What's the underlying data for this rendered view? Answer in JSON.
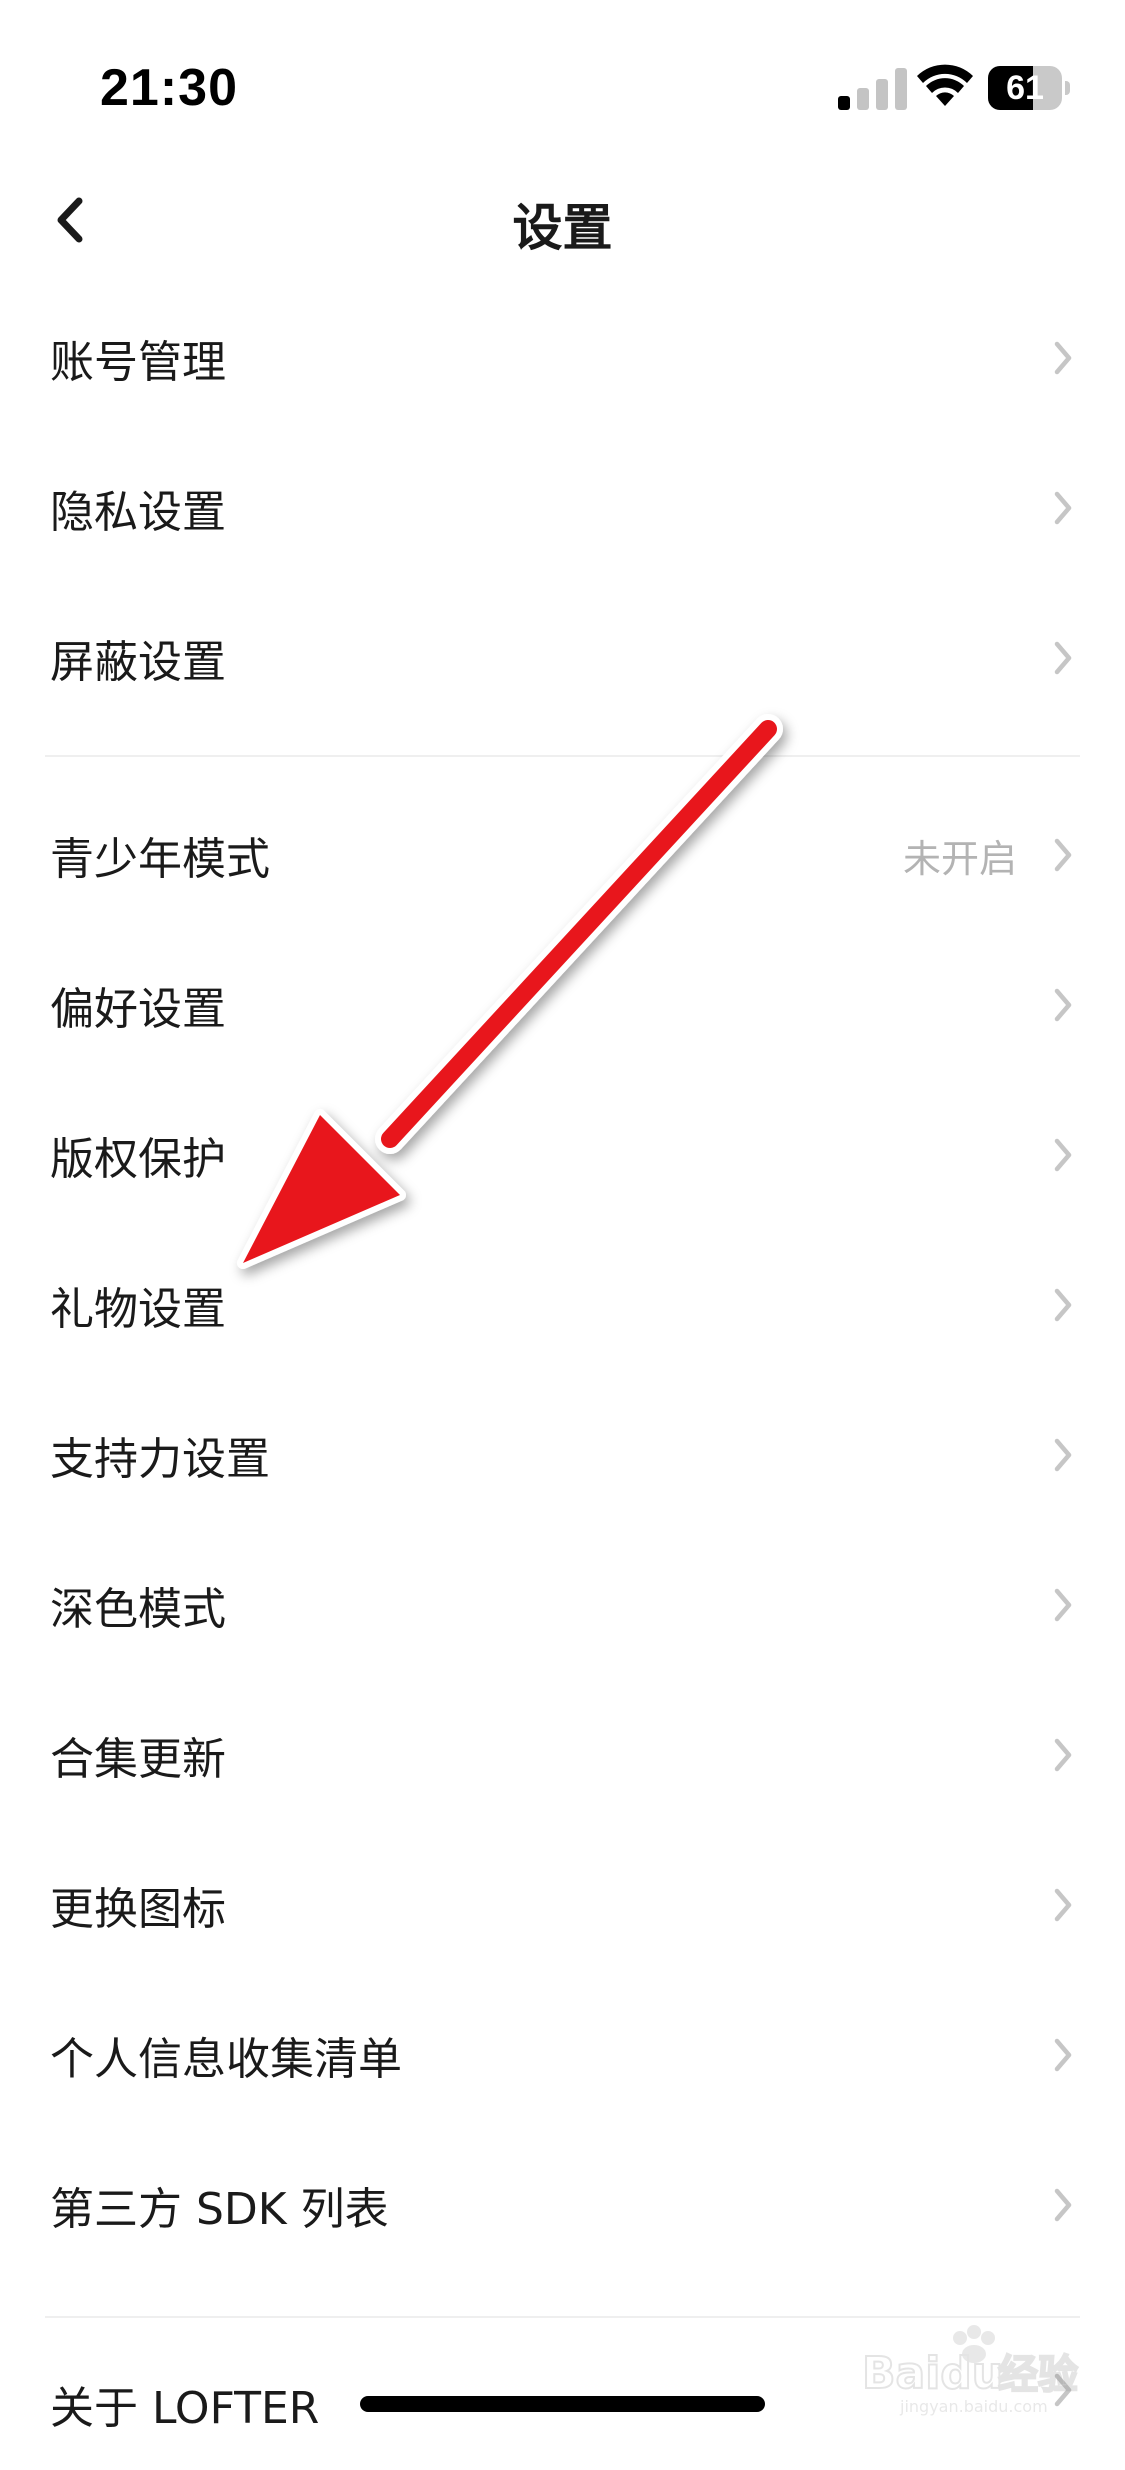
{
  "status_bar": {
    "time": "21:30",
    "battery_level": "61",
    "battery_fraction": 0.61,
    "icons": [
      "signal-icon",
      "wifi-icon",
      "battery-icon"
    ]
  },
  "nav": {
    "title": "设置",
    "back_icon": "chevron-left-icon"
  },
  "settings": {
    "group1": [
      {
        "label": "账号管理"
      },
      {
        "label": "隐私设置"
      },
      {
        "label": "屏蔽设置"
      }
    ],
    "group2": [
      {
        "label": "青少年模式",
        "value": "未开启"
      },
      {
        "label": "偏好设置"
      },
      {
        "label": "版权保护"
      },
      {
        "label": "礼物设置"
      },
      {
        "label": "支持力设置"
      },
      {
        "label": "深色模式"
      },
      {
        "label": "合集更新"
      },
      {
        "label": "更换图标"
      },
      {
        "label": "个人信息收集清单"
      },
      {
        "label": "第三方 SDK 列表"
      }
    ],
    "group3": [
      {
        "label": "关于 LOFTER"
      }
    ]
  },
  "annotation": {
    "arrow_color": "#e8161b"
  },
  "watermark": {
    "text": "Baidu经验",
    "subtext": "jingyan.baidu.com"
  },
  "colors": {
    "background": "#ffffff",
    "text": "#1a1a1a",
    "secondary_text": "#b3b3b3",
    "chevron": "#c6c6c6",
    "divider": "#efefef"
  }
}
